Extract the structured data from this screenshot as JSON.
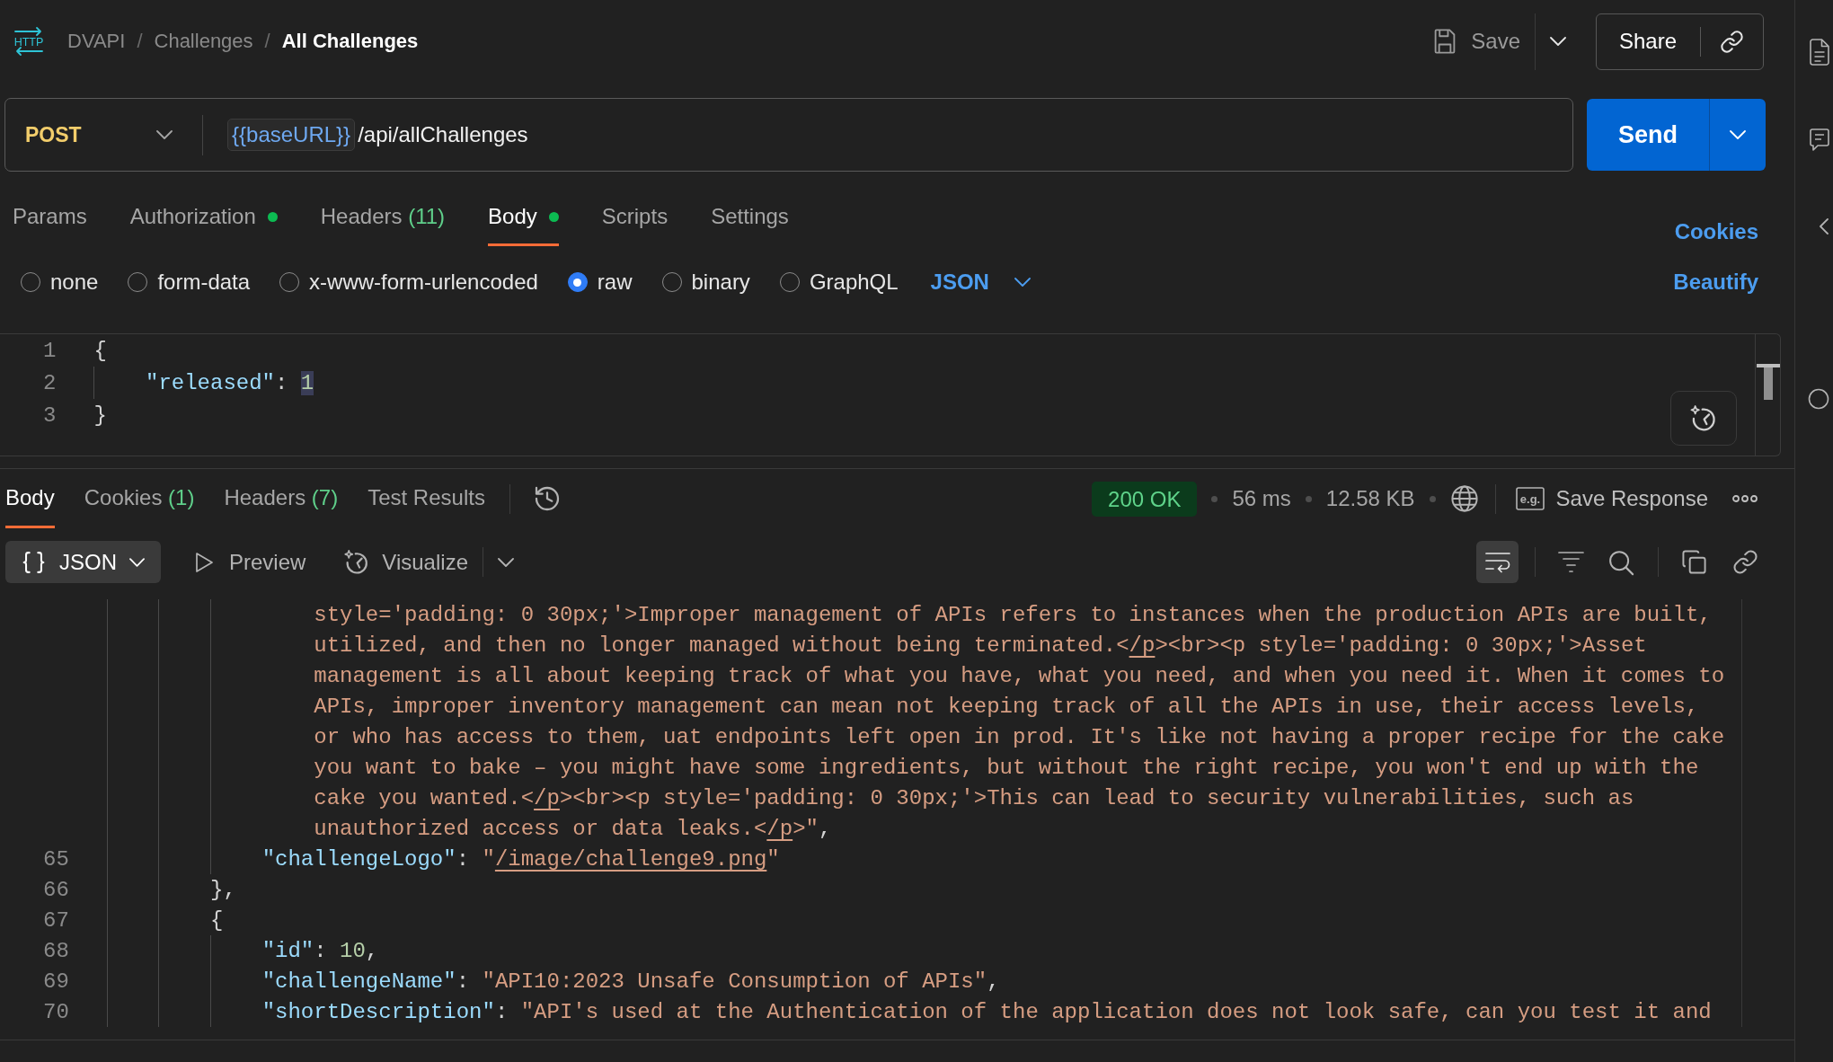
{
  "breadcrumb": {
    "icon_label": "HTTP",
    "items": [
      {
        "label": "DVAPI",
        "current": false
      },
      {
        "separator": "/",
        "label": "Challenges",
        "current": false
      },
      {
        "separator": "/",
        "label": "All Challenges",
        "current": true
      }
    ]
  },
  "header_actions": {
    "save_label": "Save",
    "share_label": "Share"
  },
  "request": {
    "method": "POST",
    "url_variable": "{{baseURL}}",
    "url_path": "/api/allChallenges",
    "send_label": "Send"
  },
  "request_tabs": [
    {
      "label": "Params",
      "selected": false,
      "indicator": false
    },
    {
      "label": "Authorization",
      "selected": false,
      "indicator": true
    },
    {
      "label": "Headers",
      "count": "(11)",
      "selected": false,
      "indicator": false
    },
    {
      "label": "Body",
      "selected": true,
      "indicator": true
    },
    {
      "label": "Scripts",
      "selected": false,
      "indicator": false
    },
    {
      "label": "Settings",
      "selected": false,
      "indicator": false
    }
  ],
  "cookies_link": "Cookies",
  "body_types": [
    {
      "label": "none",
      "selected": false
    },
    {
      "label": "form-data",
      "selected": false
    },
    {
      "label": "x-www-form-urlencoded",
      "selected": false
    },
    {
      "label": "raw",
      "selected": true
    },
    {
      "label": "binary",
      "selected": false
    },
    {
      "label": "GraphQL",
      "selected": false
    }
  ],
  "body_format": "JSON",
  "beautify_link": "Beautify",
  "request_editor": {
    "children": [
      {
        "kind": "line",
        "number": "1",
        "tokens": [
          {
            "kind": "punct",
            "text": "{"
          }
        ]
      },
      {
        "children": [
          {
            "kind": "line",
            "number": "2",
            "tokens": [
              {
                "kind": "key",
                "text": "\"released\""
              },
              {
                "kind": "punct",
                "text": ": "
              },
              {
                "kind": "number",
                "text": "1",
                "highlighted": true
              }
            ]
          }
        ]
      },
      {
        "kind": "line",
        "number": "3",
        "tokens": [
          {
            "kind": "punct",
            "text": "}"
          }
        ]
      }
    ]
  },
  "response_tabs": [
    {
      "label": "Body",
      "selected": true
    },
    {
      "label": "Cookies",
      "count": "(1)",
      "selected": false
    },
    {
      "label": "Headers",
      "count": "(7)",
      "selected": false
    },
    {
      "label": "Test Results",
      "selected": false
    }
  ],
  "response_meta": {
    "status": "200 OK",
    "time": "56 ms",
    "size": "12.58 KB",
    "save_icon_label": "e.g.",
    "save_label": "Save Response"
  },
  "response_toolbar": {
    "format": "JSON",
    "preview_label": "Preview",
    "visualize_label": "Visualize",
    "wrap_lines": true
  },
  "response_body": {
    "children": [
      {
        "children": [
          {
            "children": [
              {
                "children": [
                  {
                    "kind": "wrap",
                    "tokens": [
                      {
                        "kind": "string",
                        "text": "style='padding: 0 30px;'>Improper management of APIs refers to instances when the production APIs are built,"
                      }
                    ]
                  },
                  {
                    "kind": "wrap",
                    "tokens": [
                      {
                        "kind": "string",
                        "text": "utilized, and then no longer managed without being terminated.<"
                      },
                      {
                        "kind": "link",
                        "text": "/p"
                      },
                      {
                        "kind": "string",
                        "text": "><br><p style='padding: 0 30px;'>Asset"
                      }
                    ]
                  },
                  {
                    "kind": "wrap",
                    "tokens": [
                      {
                        "kind": "string",
                        "text": "management is all about keeping track of what you have, what you need, and when you need it. When it comes to"
                      }
                    ]
                  },
                  {
                    "kind": "wrap",
                    "tokens": [
                      {
                        "kind": "string",
                        "text": "APIs, improper inventory management can mean not keeping track of all the APIs in use, their access levels,"
                      }
                    ]
                  },
                  {
                    "kind": "wrap",
                    "tokens": [
                      {
                        "kind": "string",
                        "text": "or who has access to them, uat endpoints left open in prod. It's like not having a proper recipe for the cake"
                      }
                    ]
                  },
                  {
                    "kind": "wrap",
                    "tokens": [
                      {
                        "kind": "string",
                        "text": "you want to bake – you might have some ingredients, but without the right recipe, you won't end up with the"
                      }
                    ]
                  },
                  {
                    "kind": "wrap",
                    "tokens": [
                      {
                        "kind": "string",
                        "text": "cake you wanted.<"
                      },
                      {
                        "kind": "link",
                        "text": "/p"
                      },
                      {
                        "kind": "string",
                        "text": "><br><p style='padding: 0 30px;'>This can lead to security vulnerabilities, such as"
                      }
                    ]
                  },
                  {
                    "kind": "wrap",
                    "tokens": [
                      {
                        "kind": "string",
                        "text": "unauthorized access or data leaks.<"
                      },
                      {
                        "kind": "link",
                        "text": "/p"
                      },
                      {
                        "kind": "string",
                        "text": ">\""
                      },
                      {
                        "kind": "punct",
                        "text": ","
                      }
                    ]
                  },
                  {
                    "kind": "line",
                    "number": "65",
                    "tokens": [
                      {
                        "kind": "key",
                        "text": "\"challengeLogo\""
                      },
                      {
                        "kind": "punct",
                        "text": ": "
                      },
                      {
                        "kind": "string",
                        "text": "\""
                      },
                      {
                        "kind": "link",
                        "text": "/image/challenge9.png"
                      },
                      {
                        "kind": "string",
                        "text": "\""
                      }
                    ]
                  }
                ]
              },
              {
                "kind": "line",
                "number": "66",
                "tokens": [
                  {
                    "kind": "punct",
                    "text": "},"
                  }
                ]
              },
              {
                "kind": "line",
                "number": "67",
                "tokens": [
                  {
                    "kind": "punct",
                    "text": "{"
                  }
                ]
              },
              {
                "children": [
                  {
                    "kind": "line",
                    "number": "68",
                    "tokens": [
                      {
                        "kind": "key",
                        "text": "\"id\""
                      },
                      {
                        "kind": "punct",
                        "text": ": "
                      },
                      {
                        "kind": "number",
                        "text": "10"
                      },
                      {
                        "kind": "punct",
                        "text": ","
                      }
                    ]
                  },
                  {
                    "kind": "line",
                    "number": "69",
                    "tokens": [
                      {
                        "kind": "key",
                        "text": "\"challengeName\""
                      },
                      {
                        "kind": "punct",
                        "text": ": "
                      },
                      {
                        "kind": "string",
                        "text": "\"API10:2023 Unsafe Consumption of APIs\""
                      },
                      {
                        "kind": "punct",
                        "text": ","
                      }
                    ]
                  },
                  {
                    "kind": "line",
                    "number": "70",
                    "tokens": [
                      {
                        "kind": "key",
                        "text": "\"shortDescription\""
                      },
                      {
                        "kind": "punct",
                        "text": ": "
                      },
                      {
                        "kind": "string",
                        "text": "\"API's used at the Authentication of the application does not look safe, can you test it and"
                      }
                    ]
                  }
                ]
              }
            ]
          }
        ]
      }
    ]
  }
}
